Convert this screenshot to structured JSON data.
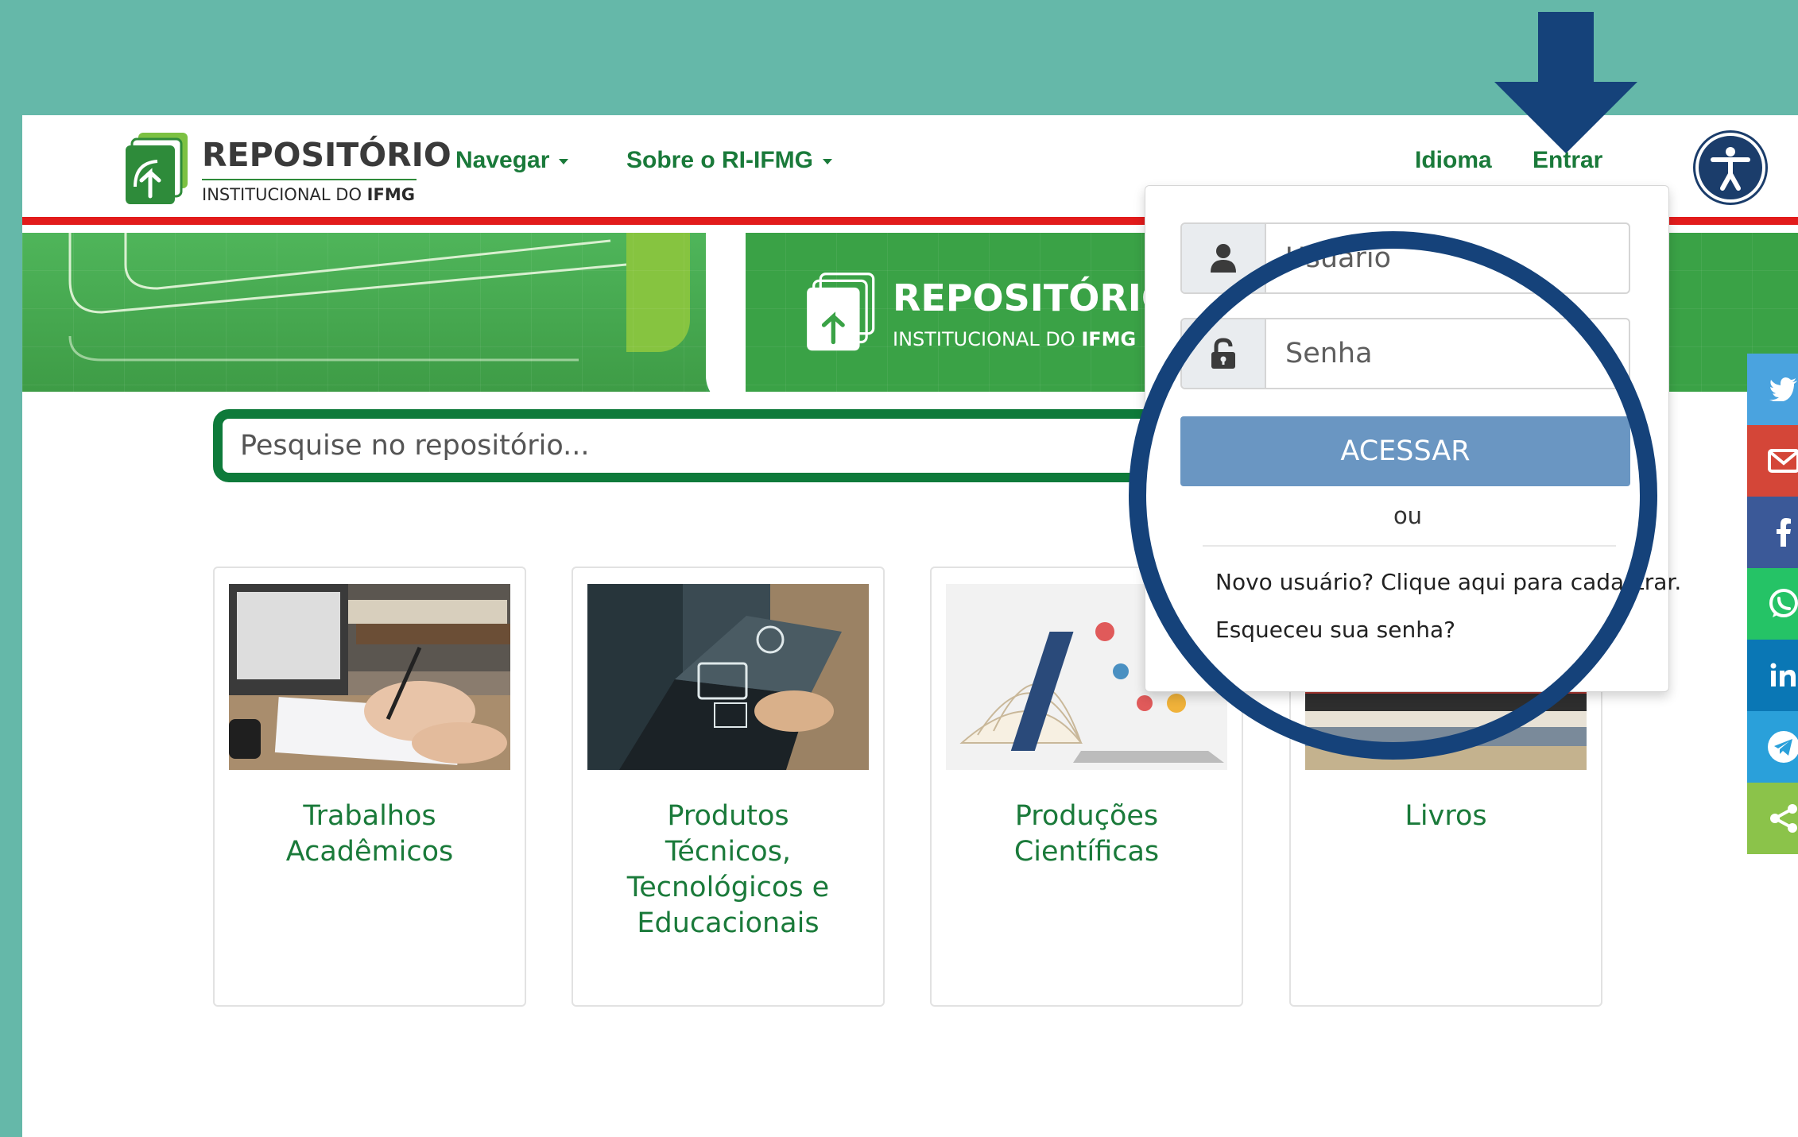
{
  "logo": {
    "title": "REPOSITÓRIO",
    "subtitle_prefix": "INSTITUCIONAL DO ",
    "subtitle_bold": "IFMG"
  },
  "nav": {
    "browse_label": "Navegar",
    "about_label": "Sobre o RI-IFMG",
    "language_label": "Idioma",
    "login_label": "Entrar"
  },
  "banner": {
    "title": "REPOSITÓRIO",
    "subtitle_prefix": "INSTITUCIONAL DO ",
    "subtitle_bold": "IFMG"
  },
  "search": {
    "placeholder": "Pesquise no repositório..."
  },
  "login": {
    "username_placeholder": "Usuário",
    "password_placeholder": "Senha",
    "submit_label": "ACESSAR",
    "or_text": "ou",
    "register_link": "Novo usuário? Clique aqui para cadastrar.",
    "forgot_link": "Esqueceu sua senha?"
  },
  "cards": [
    {
      "title_line1": "Trabalhos",
      "title_line2": "Acadêmicos",
      "title_line3": "",
      "title_line4": ""
    },
    {
      "title_line1": "Produtos",
      "title_line2": "Técnicos,",
      "title_line3": "Tecnológicos e",
      "title_line4": "Educacionais"
    },
    {
      "title_line1": "Produções",
      "title_line2": "Científicas",
      "title_line3": "",
      "title_line4": ""
    },
    {
      "title_line1": "Livros",
      "title_line2": "",
      "title_line3": "",
      "title_line4": ""
    }
  ],
  "share": {
    "items": [
      {
        "icon": "twitter-icon",
        "color": "#4aa3df",
        "label": "t"
      },
      {
        "icon": "email-icon",
        "color": "#d44638",
        "label": ""
      },
      {
        "icon": "facebook-icon",
        "color": "#3b5998",
        "label": "f"
      },
      {
        "icon": "whatsapp-icon",
        "color": "#25c366",
        "label": ""
      },
      {
        "icon": "linkedin-icon",
        "color": "#0a77b5",
        "label": "in"
      },
      {
        "icon": "telegram-icon",
        "color": "#2aa0da",
        "label": ""
      },
      {
        "icon": "share-icon",
        "color": "#8bc34a",
        "label": ""
      }
    ]
  },
  "colors": {
    "page_background": "#65b8a9",
    "brand_green": "#1a7a3a",
    "highlight_ring": "#15427a",
    "header_rule": "#e21b1b",
    "submit_button": "#6a96c2"
  }
}
